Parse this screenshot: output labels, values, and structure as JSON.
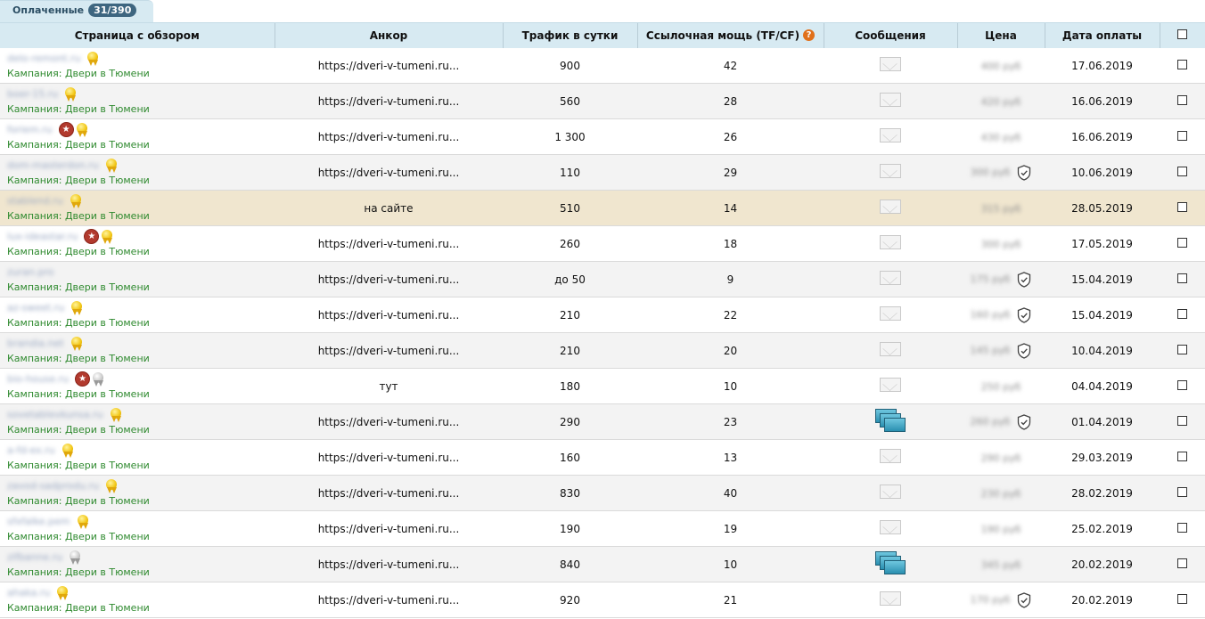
{
  "tab": {
    "label": "Оплаченные",
    "count": "31/390"
  },
  "columns": {
    "page": "Страница с обзором",
    "anchor": "Анкор",
    "traffic": "Трафик в сутки",
    "power": "Ссылочная мощь (TF/CF)",
    "messages": "Сообщения",
    "price": "Цена",
    "date": "Дата оплаты"
  },
  "rows": [
    {
      "site": "delo-remont.ru",
      "campaign": "Кампания: Двери в Тюмени",
      "badges": [
        "gold"
      ],
      "anchor": "https://dveri-v-tumeni.ru...",
      "traffic": "900",
      "power": "42",
      "message": "plain",
      "price": "400 руб",
      "shield": false,
      "date": "17.06.2019",
      "style": "white"
    },
    {
      "site": "boer-15.ru",
      "campaign": "Кампания: Двери в Тюмени",
      "badges": [
        "gold"
      ],
      "anchor": "https://dveri-v-tumeni.ru...",
      "traffic": "560",
      "power": "28",
      "message": "plain",
      "price": "420 руб",
      "shield": false,
      "date": "16.06.2019",
      "style": "gray"
    },
    {
      "site": "foriem.ru",
      "campaign": "Кампания: Двери в Тюмени",
      "badges": [
        "star",
        "gold"
      ],
      "anchor": "https://dveri-v-tumeni.ru...",
      "traffic": "1 300",
      "power": "26",
      "message": "plain",
      "price": "430 руб",
      "shield": false,
      "date": "16.06.2019",
      "style": "white"
    },
    {
      "site": "dom-masterdon.ru",
      "campaign": "Кампания: Двери в Тюмени",
      "badges": [
        "gold"
      ],
      "anchor": "https://dveri-v-tumeni.ru...",
      "traffic": "110",
      "power": "29",
      "message": "plain",
      "price": "300 руб",
      "shield": true,
      "date": "10.06.2019",
      "style": "gray"
    },
    {
      "site": "stablend.ru",
      "campaign": "Кампания: Двери в Тюмени",
      "badges": [
        "gold"
      ],
      "anchor": "на сайте",
      "traffic": "510",
      "power": "14",
      "message": "plain",
      "price": "315 руб",
      "shield": false,
      "date": "28.05.2019",
      "style": "hl"
    },
    {
      "site": "lux-ideastar.ru",
      "campaign": "Кампания: Двери в Тюмени",
      "badges": [
        "star",
        "gold"
      ],
      "anchor": "https://dveri-v-tumeni.ru...",
      "traffic": "260",
      "power": "18",
      "message": "plain",
      "price": "300 руб",
      "shield": false,
      "date": "17.05.2019",
      "style": "white"
    },
    {
      "site": "zuran.pro",
      "campaign": "Кампания: Двери в Тюмени",
      "badges": [],
      "anchor": "https://dveri-v-tumeni.ru...",
      "traffic": "до 50",
      "power": "9",
      "message": "plain",
      "price": "175 руб",
      "shield": true,
      "date": "15.04.2019",
      "style": "gray"
    },
    {
      "site": "az-sweet.ru",
      "campaign": "Кампания: Двери в Тюмени",
      "badges": [
        "gold"
      ],
      "anchor": "https://dveri-v-tumeni.ru...",
      "traffic": "210",
      "power": "22",
      "message": "plain",
      "price": "160 руб",
      "shield": true,
      "date": "15.04.2019",
      "style": "white"
    },
    {
      "site": "brandia.net",
      "campaign": "Кампания: Двери в Тюмени",
      "badges": [
        "gold"
      ],
      "anchor": "https://dveri-v-tumeni.ru...",
      "traffic": "210",
      "power": "20",
      "message": "plain",
      "price": "145 руб",
      "shield": true,
      "date": "10.04.2019",
      "style": "gray"
    },
    {
      "site": "bio-house.ru",
      "campaign": "Кампания: Двери в Тюмени",
      "badges": [
        "star",
        "silver"
      ],
      "anchor": "тут",
      "traffic": "180",
      "power": "10",
      "message": "plain",
      "price": "250 руб",
      "shield": false,
      "date": "04.04.2019",
      "style": "white"
    },
    {
      "site": "sovetablevkunsa.ru",
      "campaign": "Кампания: Двери в Тюмени",
      "badges": [
        "gold"
      ],
      "anchor": "https://dveri-v-tumeni.ru...",
      "traffic": "290",
      "power": "23",
      "message": "blue",
      "price": "260 руб",
      "shield": true,
      "date": "01.04.2019",
      "style": "gray"
    },
    {
      "site": "a-fd-ex.ru",
      "campaign": "Кампания: Двери в Тюмени",
      "badges": [
        "gold"
      ],
      "anchor": "https://dveri-v-tumeni.ru...",
      "traffic": "160",
      "power": "13",
      "message": "plain",
      "price": "290 руб",
      "shield": false,
      "date": "29.03.2019",
      "style": "white"
    },
    {
      "site": "zavod-sadprodu.ru",
      "campaign": "Кампания: Двери в Тюмени",
      "badges": [
        "gold"
      ],
      "anchor": "https://dveri-v-tumeni.ru...",
      "traffic": "830",
      "power": "40",
      "message": "plain",
      "price": "230 руб",
      "shield": false,
      "date": "28.02.2019",
      "style": "gray"
    },
    {
      "site": "sfxfalke.pem",
      "campaign": "Кампания: Двери в Тюмени",
      "badges": [
        "gold"
      ],
      "anchor": "https://dveri-v-tumeni.ru...",
      "traffic": "190",
      "power": "19",
      "message": "plain",
      "price": "190 руб",
      "shield": false,
      "date": "25.02.2019",
      "style": "white"
    },
    {
      "site": "zifbanne.ru",
      "campaign": "Кампания: Двери в Тюмени",
      "badges": [
        "silver"
      ],
      "anchor": "https://dveri-v-tumeni.ru...",
      "traffic": "840",
      "power": "10",
      "message": "blue",
      "price": "345 руб",
      "shield": false,
      "date": "20.02.2019",
      "style": "gray"
    },
    {
      "site": "ahaka.ru",
      "campaign": "Кампания: Двери в Тюмени",
      "badges": [
        "gold"
      ],
      "anchor": "https://dveri-v-tumeni.ru...",
      "traffic": "920",
      "power": "21",
      "message": "plain",
      "price": "170 руб",
      "shield": true,
      "date": "20.02.2019",
      "style": "white"
    }
  ]
}
